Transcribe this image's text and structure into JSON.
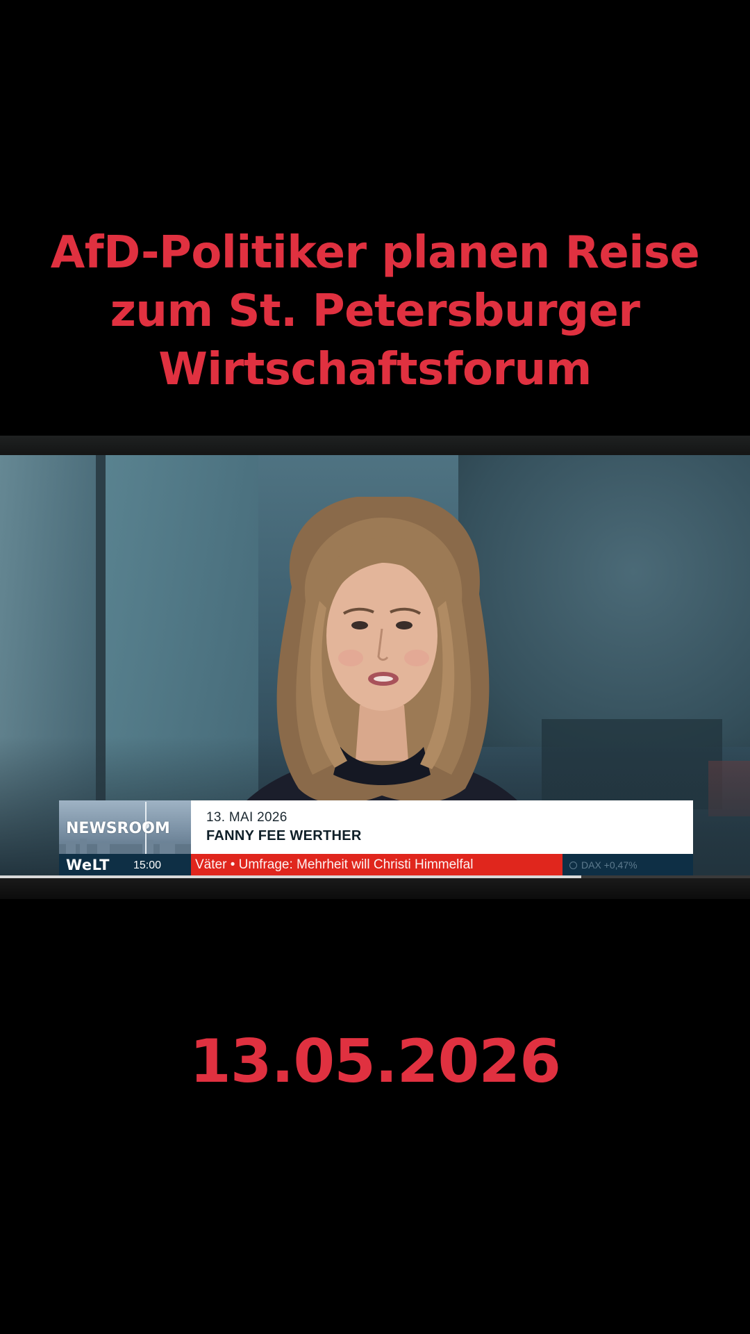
{
  "headline": {
    "lines": [
      "AfD-Politiker planen Reise",
      "zum St. Petersburger",
      "Wirtschaftsforum"
    ],
    "color": "#e03140"
  },
  "video": {
    "lower_third": {
      "show_label": "NEWSROOM",
      "date": "13. MAI 2026",
      "presenter_name": "FANNY FEE WERTHER",
      "channel_logo": "WeLT",
      "time": "15:00",
      "ticker_text": "Väter  • Umfrage: Mehrheit will Christi Himmelfal",
      "market_text": "DAX +0,47%",
      "ticker_color": "#e0261d",
      "bar_color": "#0e2f45"
    },
    "progress_fraction": 0.775
  },
  "date_caption": "13.05.2026"
}
